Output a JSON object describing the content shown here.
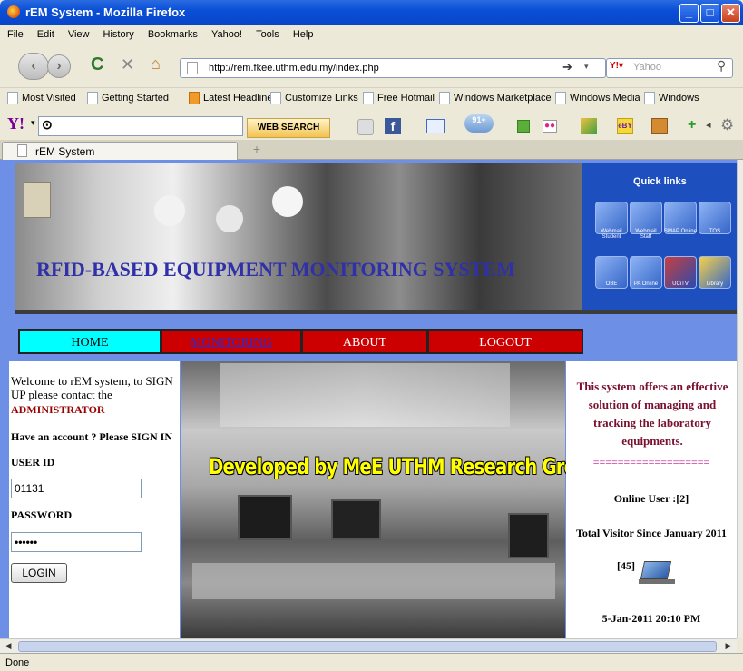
{
  "window": {
    "title": "rEM System - Mozilla Firefox"
  },
  "menubar": [
    "File",
    "Edit",
    "View",
    "History",
    "Bookmarks",
    "Yahoo!",
    "Tools",
    "Help"
  ],
  "nav": {
    "url": "http://rem.fkee.uthm.edu.my/index.php",
    "search_placeholder": "Yahoo"
  },
  "bookmarks": [
    "Most Visited",
    "Getting Started",
    "Latest Headlines",
    "Customize Links",
    "Free Hotmail",
    "Windows Marketplace",
    "Windows Media",
    "Windows"
  ],
  "yahoo_toolbar": {
    "web_search": "WEB SEARCH",
    "mail_count": "91+"
  },
  "tab": {
    "title": "rEM System",
    "new_tab": "+"
  },
  "page": {
    "banner": "RFID-BASED EQUIPMENT MONITORING SYSTEM",
    "quick_links": {
      "title": "Quick links",
      "items": [
        "Webmail Student",
        "Webmail Staff",
        "SMAP Online",
        "TOS",
        "OBE",
        "PA Online",
        "UCiTV",
        "Library"
      ]
    },
    "menu": {
      "home": "HOME",
      "monitoring": "MONITORING",
      "about": "ABOUT",
      "logout": "LOGOUT"
    },
    "colors": {
      "menu_active": "#00ffff",
      "menu_inactive": "#cc0000",
      "banner_text": "#3030a8",
      "background": "#6e8fe6"
    },
    "login": {
      "welcome": "Welcome to rEM system, to SIGN UP please contact the",
      "admin": "ADMINISTRATOR",
      "have_account": "Have an account ? Please SIGN IN",
      "user_id_label": "USER ID",
      "user_id_value": "01131",
      "password_label": "PASSWORD",
      "password_value": "••••••",
      "login_button": "LOGIN"
    },
    "center_caption": "Developed by MeE UTHM Research Group",
    "info": {
      "description": "This system offers an effective solution of managing and tracking the laboratory equipments.",
      "separator": "===================",
      "online_user": "Online User :[2]",
      "total_visitor": "Total Visitor Since January 2011",
      "visitor_count": "[45]",
      "datetime": "5-Jan-2011 20:10 PM"
    }
  },
  "status": "Done"
}
